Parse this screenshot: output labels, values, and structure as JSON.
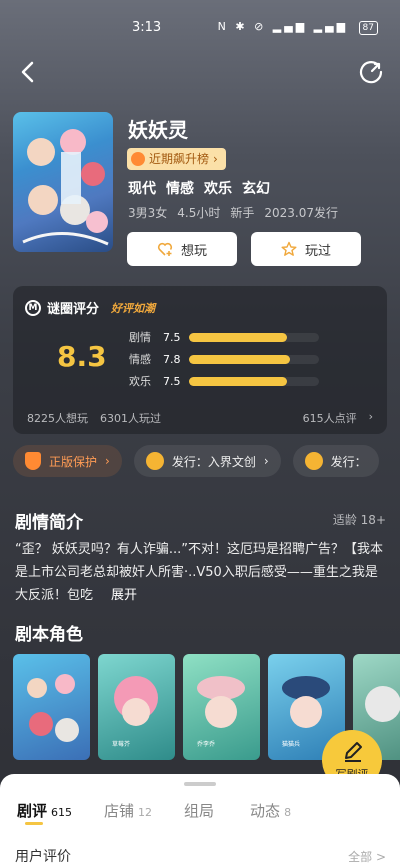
{
  "status": {
    "time": "3:13",
    "icons": "N ✱ ⊘ ▂▄▆ ▂▄▆",
    "battery": "87"
  },
  "nav": {
    "back_icon": "back-arrow-icon",
    "share_icon": "refresh-share-icon"
  },
  "game": {
    "title": "妖妖灵",
    "rank_badge": "近期飙升榜",
    "tags": [
      "现代",
      "情感",
      "欢乐",
      "玄幻"
    ],
    "meta": [
      "3男3女",
      "4.5小时",
      "新手",
      "2023.07发行"
    ]
  },
  "actions": {
    "want": "想玩",
    "played": "玩过"
  },
  "rating": {
    "brand": "谜圈评分",
    "badge": "好评如潮",
    "score": "8.3",
    "items": [
      {
        "label": "剧情",
        "value": "7.5",
        "fill": 0.75
      },
      {
        "label": "情感",
        "value": "7.8",
        "fill": 0.78
      },
      {
        "label": "欢乐",
        "value": "7.5",
        "fill": 0.75
      }
    ],
    "want_count": "8225人想玩",
    "played_count": "6301人玩过",
    "review_count": "615人点评"
  },
  "chips": [
    "正版保护",
    "发行：入界文创",
    "发行："
  ],
  "intro": {
    "title": "剧情简介",
    "age": "适龄 18+",
    "text": "“歪？ 妖妖灵吗？有人诈骗...”不对！这厄玛是招聘广告？【我本是上市公司老总却被奸人所害·..V50入职后感受——重生之我是大反派！包吃",
    "more": "展开"
  },
  "roles": {
    "title": "剧本角色",
    "names": [
      "",
      "草莓芥",
      "乔李乔",
      "猫猫兵",
      ""
    ]
  },
  "fab": {
    "label": "写剧评"
  },
  "sheet": {
    "tabs": [
      {
        "label": "剧评",
        "count": "615"
      },
      {
        "label": "店铺",
        "count": "12"
      },
      {
        "label": "组局",
        "count": ""
      },
      {
        "label": "动态",
        "count": "8"
      }
    ],
    "review_title": "用户评价",
    "all": "全部 >"
  }
}
